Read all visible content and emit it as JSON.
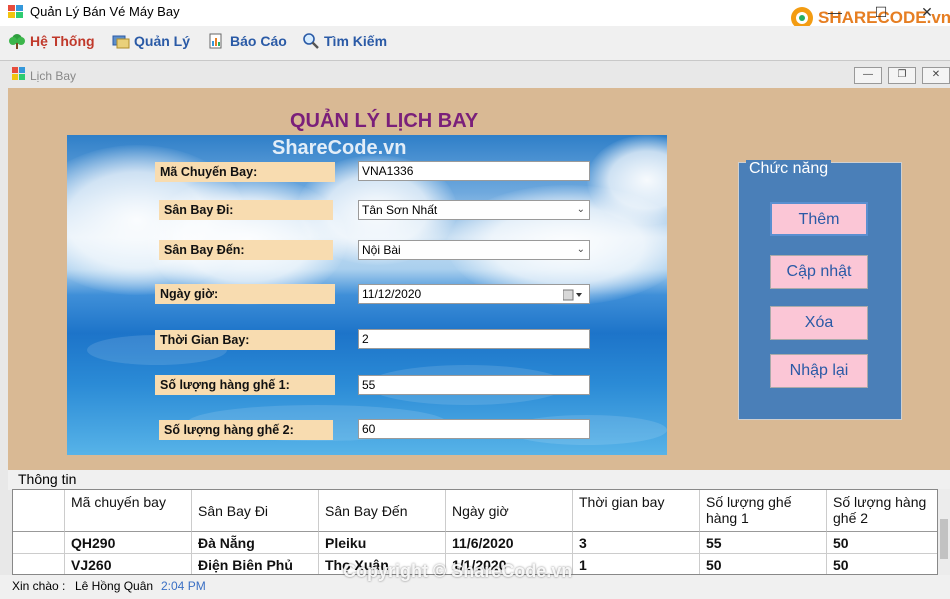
{
  "app": {
    "title": "Quản Lý Bán Vé Máy Bay",
    "window_buttons": {
      "minimize": "—",
      "maximize": "☐",
      "close": "✕"
    }
  },
  "brand": {
    "logo_text": "SHARECODE.vn"
  },
  "menu": [
    {
      "label": "Hệ Thống",
      "icon": "tree-icon",
      "color": "#c0392b"
    },
    {
      "label": "Quản Lý",
      "icon": "cards-icon",
      "color": "#2a5aa6"
    },
    {
      "label": "Báo Cáo",
      "icon": "report-icon",
      "color": "#2a5aa6"
    },
    {
      "label": "Tìm Kiếm",
      "icon": "search-icon",
      "color": "#2a5aa6"
    }
  ],
  "child_window": {
    "title": "Lịch Bay",
    "buttons": {
      "minimize": "—",
      "restore": "❐",
      "close": "✕"
    }
  },
  "form": {
    "heading": "QUẢN LÝ LỊCH BAY",
    "watermark": "ShareCode.vn",
    "fields": [
      {
        "label": "Mã Chuyến Bay:",
        "value": "VNA1336",
        "type": "text"
      },
      {
        "label": "Sân Bay Đi:",
        "value": "Tân Sơn Nhất",
        "type": "select"
      },
      {
        "label": "Sân Bay Đến:",
        "value": "Nội Bài",
        "type": "select"
      },
      {
        "label": "Ngày giờ:",
        "value": "11/12/2020",
        "type": "date"
      },
      {
        "label": "Thời Gian Bay:",
        "value": "2",
        "type": "text"
      },
      {
        "label": "Số lượng hàng ghế 1:",
        "value": "55",
        "type": "text"
      },
      {
        "label": "Số lượng hàng ghế 2:",
        "value": "60",
        "type": "text"
      }
    ]
  },
  "functions": {
    "legend": "Chức năng",
    "buttons": [
      "Thêm",
      "Cập nhật",
      "Xóa",
      "Nhập lại"
    ]
  },
  "info": {
    "label": "Thông tin",
    "columns": [
      "Mã chuyến bay",
      "Sân Bay Đi",
      "Sân Bay Đến",
      "Ngày giờ",
      "Thời gian bay",
      "Số lượng ghế hàng 1",
      "Số lượng hàng ghế 2"
    ],
    "rows": [
      [
        "QH290",
        "Đà Nẵng",
        "Pleiku",
        "11/6/2020",
        "3",
        "55",
        "50"
      ],
      [
        "VJ260",
        "Điện Biên Phủ",
        "Thọ Xuân",
        "1/1/2020",
        "1",
        "50",
        "50"
      ]
    ]
  },
  "status": {
    "greeting": "Xin chào :",
    "user": "Lê Hồng Quân",
    "time": "2:04 PM"
  },
  "footer_watermark": "Copyright © ShareCode.vn"
}
